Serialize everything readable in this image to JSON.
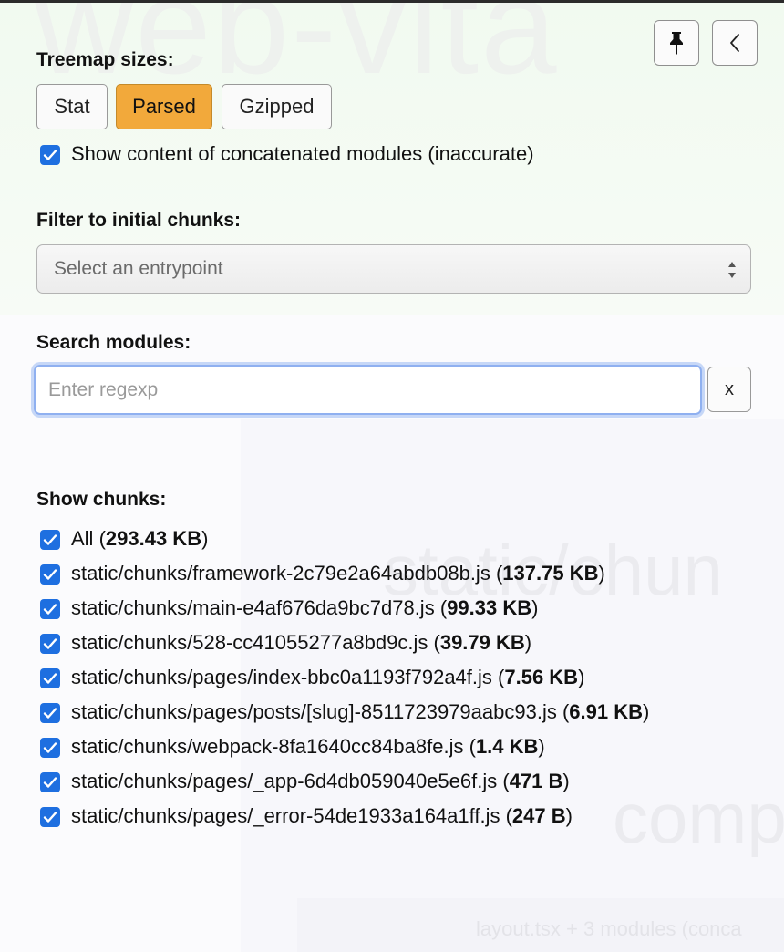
{
  "background": {
    "ghost_title": "web-vita",
    "ghost_chunk": "static/chun",
    "ghost_comp": "comp",
    "ghost_layout": "layout.tsx + 3 modules (conca"
  },
  "header": {
    "pin_icon": "pushpin-icon",
    "back_icon": "chevron-left-icon"
  },
  "treemap": {
    "title": "Treemap sizes:",
    "buttons": [
      "Stat",
      "Parsed",
      "Gzipped"
    ],
    "active": "Parsed",
    "active_color": "#f2a93b",
    "concat_label": "Show content of concatenated modules (inaccurate)",
    "concat_checked": true
  },
  "filter": {
    "title": "Filter to initial chunks:",
    "selected": "Select an entrypoint"
  },
  "search": {
    "title": "Search modules:",
    "placeholder": "Enter regexp",
    "value": "",
    "clear_label": "x"
  },
  "chunks": {
    "title": "Show chunks:",
    "checkbox_color": "#1e6fe0",
    "items": [
      {
        "name": "All",
        "size": "293.43 KB",
        "checked": true
      },
      {
        "name": "static/chunks/framework-2c79e2a64abdb08b.js",
        "size": "137.75 KB",
        "checked": true
      },
      {
        "name": "static/chunks/main-e4af676da9bc7d78.js",
        "size": "99.33 KB",
        "checked": true
      },
      {
        "name": "static/chunks/528-cc41055277a8bd9c.js",
        "size": "39.79 KB",
        "checked": true
      },
      {
        "name": "static/chunks/pages/index-bbc0a1193f792a4f.js",
        "size": "7.56 KB",
        "checked": true
      },
      {
        "name": "static/chunks/pages/posts/[slug]-8511723979aabc93.js",
        "size": "6.91 KB",
        "checked": true
      },
      {
        "name": "static/chunks/webpack-8fa1640cc84ba8fe.js",
        "size": "1.4 KB",
        "checked": true
      },
      {
        "name": "static/chunks/pages/_app-6d4db059040e5e6f.js",
        "size": "471 B",
        "checked": true
      },
      {
        "name": "static/chunks/pages/_error-54de1933a164a1ff.js",
        "size": "247 B",
        "checked": true
      }
    ]
  }
}
